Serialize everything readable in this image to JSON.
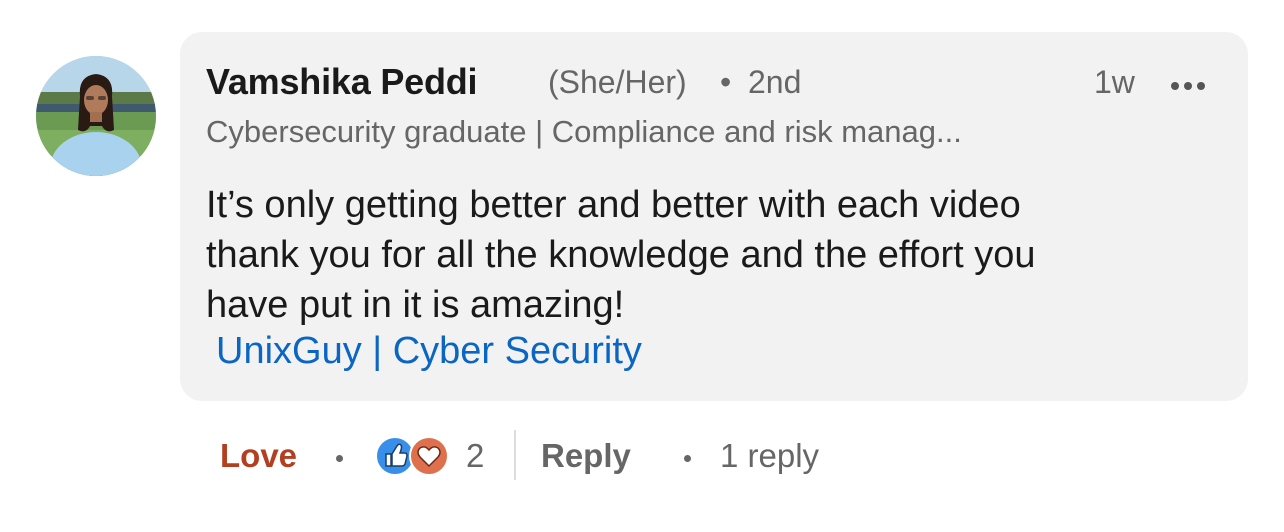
{
  "comment": {
    "author": {
      "name": "Vamshika Peddi",
      "pronouns": "(She/Her)",
      "separator": "•",
      "connection_degree": "2nd",
      "headline": "Cybersecurity graduate | Compliance and risk manag..."
    },
    "timestamp": "1w",
    "more_icon": "ellipsis-icon",
    "body_lines": [
      "It’s only getting better and better with each video",
      "thank you for all the knowledge and the effort you",
      "have put in it is amazing!"
    ],
    "mention": "UnixGuy | Cyber Security"
  },
  "actions": {
    "love_label": "Love",
    "reaction_icons": [
      "like-icon",
      "love-icon"
    ],
    "reaction_count": "2",
    "reply_label": "Reply",
    "replies_text": "1 reply"
  },
  "colors": {
    "bubble_bg": "#f2f2f2",
    "love": "#b24020",
    "mention": "#0a66c2",
    "like_reaction": "#378fe9",
    "love_reaction": "#df704d",
    "secondary_text": "#666666"
  }
}
